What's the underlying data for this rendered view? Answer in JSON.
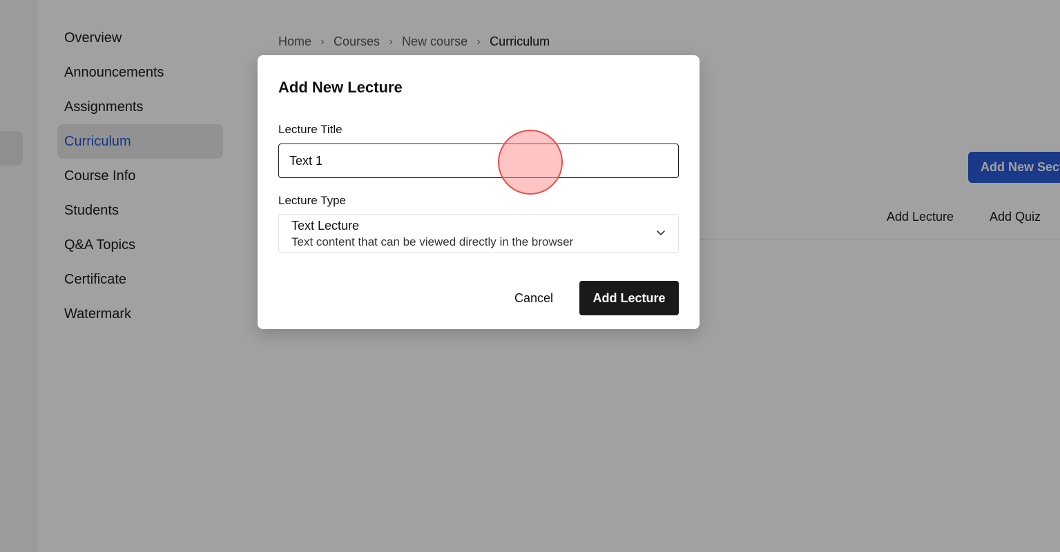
{
  "sidebar": {
    "items": [
      {
        "label": "Overview"
      },
      {
        "label": "Announcements"
      },
      {
        "label": "Assignments"
      },
      {
        "label": "Curriculum"
      },
      {
        "label": "Course Info"
      },
      {
        "label": "Students"
      },
      {
        "label": "Q&A Topics"
      },
      {
        "label": "Certificate"
      },
      {
        "label": "Watermark"
      }
    ],
    "active_item": "Curriculum"
  },
  "breadcrumb": {
    "items": [
      "Home",
      "Courses",
      "New course",
      "Curriculum"
    ]
  },
  "main": {
    "add_section_label": "Add New Sect",
    "add_lecture_label": "Add Lecture",
    "add_quiz_label": "Add Quiz"
  },
  "modal": {
    "title": "Add New Lecture",
    "lecture_title_label": "Lecture Title",
    "lecture_title_value": "Text 1",
    "lecture_type_label": "Lecture Type",
    "lecture_type_selected": "Text Lecture",
    "lecture_type_description": "Text content that can be viewed directly in the browser",
    "cancel_label": "Cancel",
    "submit_label": "Add Lecture"
  },
  "icons": {
    "breadcrumb_separator": "chevron-right-icon",
    "select_chevron": "chevron-down-icon"
  },
  "colors": {
    "accent": "#2a5bd7",
    "active_nav_text": "#2a55d9",
    "primary_button": "#1a1a1a",
    "click_indicator": "#f04a4a"
  }
}
